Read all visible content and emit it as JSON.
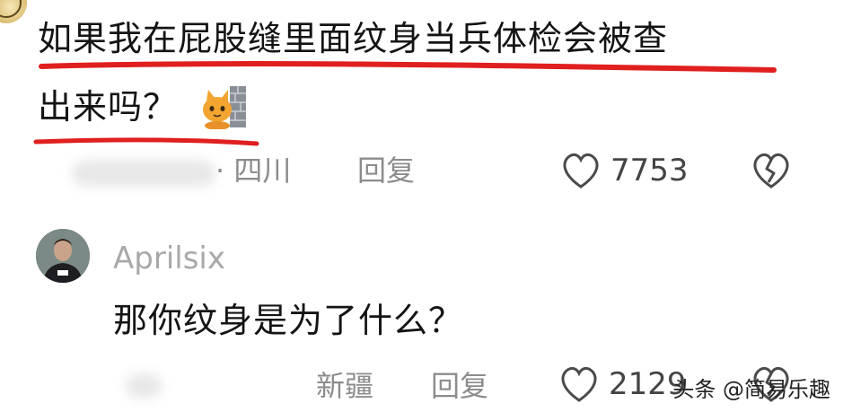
{
  "comment1": {
    "text_line1": "如果我在屁股缝里面纹身当兵体检会被查",
    "text_line2": "出来吗？",
    "emoji": "cat-peeking-behind-wall-emoji",
    "location": "· 四川",
    "reply_label": "回复",
    "like_count": "7753"
  },
  "comment2": {
    "username": "Aprilsix",
    "text": "那你纹身是为了什么？",
    "location": "新疆",
    "reply_label": "回复",
    "like_count": "2129"
  },
  "watermark": "头条 @简易乐趣",
  "colors": {
    "annotation_red": "#e01f1f",
    "meta_gray": "#8c8c8c",
    "username_gray": "#a9a9a9"
  }
}
